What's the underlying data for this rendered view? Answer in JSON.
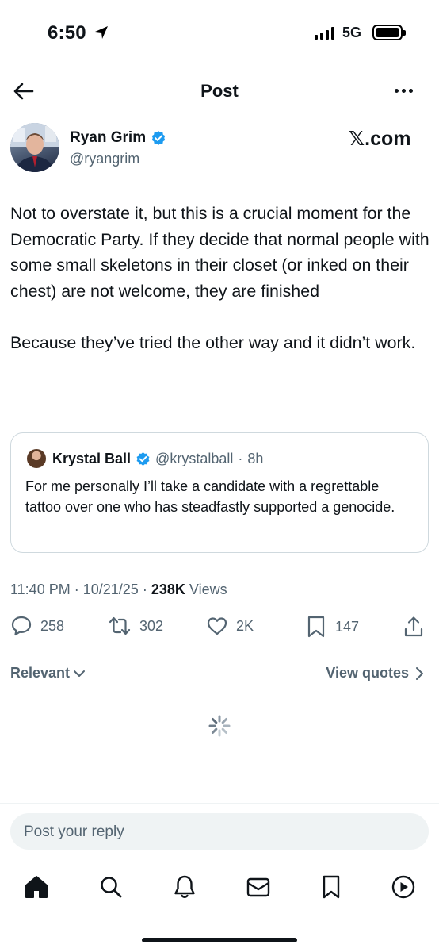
{
  "status_bar": {
    "time": "6:50",
    "network": "5G",
    "battery_level": 1.0
  },
  "header": {
    "title": "Post",
    "back_icon": "arrow-left-icon",
    "more_icon": "ellipsis-icon"
  },
  "author": {
    "name": "Ryan Grim",
    "handle": "@ryangrim",
    "verified": true,
    "source_logo": "𝕏.com"
  },
  "tweet": {
    "text": "Not to overstate it, but this is a crucial moment for the Democratic Party. If they decide that normal people with some small skeletons in their closet (or inked on their chest) are not welcome, they are finished\n\nBecause they’ve tried the other way and it didn’t work."
  },
  "quote": {
    "name": "Krystal Ball",
    "handle": "@krystalball",
    "separator": "·",
    "time": "8h",
    "verified": true,
    "text": "For me personally I’ll take a candidate with a regrettable tattoo over one who has steadfastly supported a genocide."
  },
  "meta": {
    "time": "11:40 PM",
    "dot1": "·",
    "date": "10/21/25",
    "dot2": "·",
    "views_count": "238K",
    "views_label": "Views"
  },
  "actions": {
    "replies": "258",
    "reposts": "302",
    "likes": "2K",
    "bookmarks": "147"
  },
  "replies_section": {
    "sort_label": "Relevant",
    "view_quotes_label": "View quotes"
  },
  "reply_input": {
    "placeholder": "Post your reply"
  },
  "tab_bar": {
    "items": [
      "home-icon",
      "search-icon",
      "notifications-icon",
      "messages-icon",
      "bookmarks-icon",
      "play-icon"
    ]
  },
  "colors": {
    "text": "#0f1419",
    "secondary": "#536471",
    "verified": "#1d9bf0",
    "border": "#cfd9de"
  }
}
